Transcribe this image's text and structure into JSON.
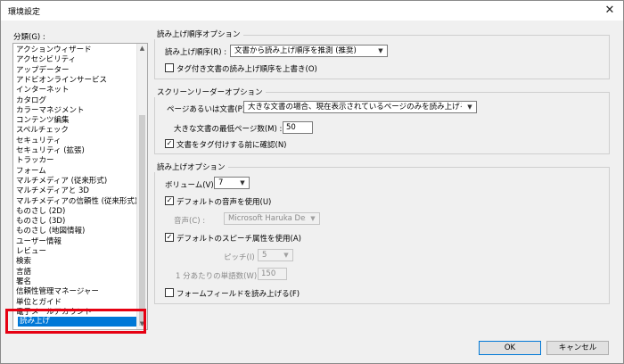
{
  "window": {
    "title": "環境設定",
    "close_glyph": "✕"
  },
  "categories": {
    "label": "分類(G) :",
    "items": [
      "アクションウィザード",
      "アクセシビリティ",
      "アップデーター",
      "アドビオンラインサービス",
      "インターネット",
      "カタログ",
      "カラーマネジメント",
      "コンテンツ編集",
      "スペルチェック",
      "セキュリティ",
      "セキュリティ (拡張)",
      "トラッカー",
      "フォーム",
      "マルチメディア (従来形式)",
      "マルチメディアと 3D",
      "マルチメディアの信頼性 (従来形式)",
      "ものさし (2D)",
      "ものさし (3D)",
      "ものさし (地図情報)",
      "ユーザー情報",
      "レビュー",
      "検索",
      "言語",
      "署名",
      "信頼性管理マネージャー",
      "単位とガイド",
      "電子メールアカウント"
    ],
    "selected": "読み上げ"
  },
  "order_group": {
    "title": "読み上げ順序オプション",
    "order_label": "読み上げ順序(R) :",
    "order_value": "文書から読み上げ順序を推測 (推奨)",
    "tagged_override_label": "タグ付き文書の読み上げ順序を上書き(O)"
  },
  "screenreader_group": {
    "title": "スクリーンリーダーオプション",
    "pages_label": "ページあるいは文書(P) :",
    "pages_value": "大きな文書の場合、現在表示されているページのみを読み上げる",
    "min_pages_label": "大きな文書の最低ページ数(M) :",
    "min_pages_value": "50",
    "confirm_label": "文書をタグ付けする前に確認(N)"
  },
  "readout_group": {
    "title": "読み上げオプション",
    "volume_label": "ボリューム(V) :",
    "volume_value": "7",
    "default_voice_label": "デフォルトの音声を使用(U)",
    "voice_label": "音声(C) :",
    "voice_value": "Microsoft Haruka Deskto",
    "default_speech_label": "デフォルトのスピーチ属性を使用(A)",
    "pitch_label": "ピッチ(I) :",
    "pitch_value": "5",
    "wpm_label": "1 分あたりの単語数(W) :",
    "wpm_value": "150",
    "form_fields_label": "フォームフィールドを読み上げる(F)"
  },
  "buttons": {
    "ok": "OK",
    "cancel": "キャンセル"
  },
  "checkboxes": {
    "tagged_override": false,
    "confirm": true,
    "default_voice": true,
    "default_speech": true,
    "form_fields": false
  },
  "colors": {
    "selection": "#0078d7",
    "highlight_frame": "#e60012"
  }
}
